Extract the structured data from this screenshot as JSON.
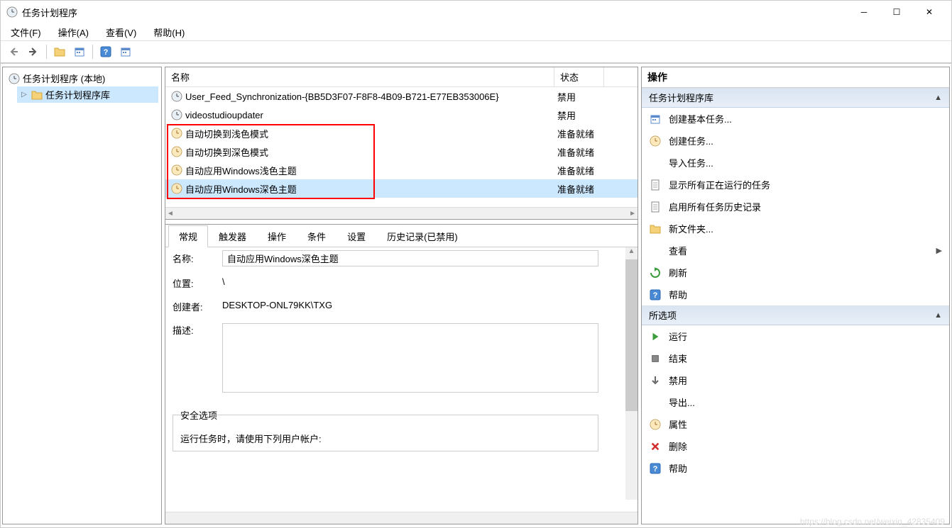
{
  "window": {
    "title": "任务计划程序"
  },
  "menu": {
    "file": "文件(F)",
    "operation": "操作(A)",
    "view": "查看(V)",
    "help": "帮助(H)"
  },
  "tree": {
    "root": "任务计划程序 (本地)",
    "library": "任务计划程序库"
  },
  "list_header": {
    "name": "名称",
    "status": "状态"
  },
  "tasks": [
    {
      "name": "User_Feed_Synchronization-{BB5D3F07-F8F8-4B09-B721-E77EB353006E}",
      "status": "禁用"
    },
    {
      "name": "videostudioupdater",
      "status": "禁用"
    },
    {
      "name": "自动切换到浅色模式",
      "status": "准备就绪"
    },
    {
      "name": "自动切换到深色模式",
      "status": "准备就绪"
    },
    {
      "name": "自动应用Windows浅色主题",
      "status": "准备就绪"
    },
    {
      "name": "自动应用Windows深色主题",
      "status": "准备就绪"
    }
  ],
  "tabs": {
    "general": "常规",
    "triggers": "触发器",
    "actions": "操作",
    "conditions": "条件",
    "settings": "设置",
    "history": "历史记录(已禁用)"
  },
  "details": {
    "name_label": "名称:",
    "name_value": "自动应用Windows深色主题",
    "location_label": "位置:",
    "location_value": "\\",
    "creator_label": "创建者:",
    "creator_value": "DESKTOP-ONL79KK\\TXG",
    "desc_label": "描述:",
    "security_title": "安全选项",
    "security_line": "运行任务时，请使用下列用户帐户:"
  },
  "actions": {
    "header": "操作",
    "section1_title": "任务计划程序库",
    "section1_items": {
      "create_basic": "创建基本任务...",
      "create_task": "创建任务...",
      "import_task": "导入任务...",
      "show_running": "显示所有正在运行的任务",
      "enable_history": "启用所有任务历史记录",
      "new_folder": "新文件夹...",
      "view": "查看",
      "refresh": "刷新",
      "help": "帮助"
    },
    "section2_title": "所选项",
    "section2_items": {
      "run": "运行",
      "end": "结束",
      "disable": "禁用",
      "export": "导出...",
      "properties": "属性",
      "delete": "删除",
      "help": "帮助"
    }
  },
  "watermark": "https://blog.csdn.net/weixin_42835409"
}
